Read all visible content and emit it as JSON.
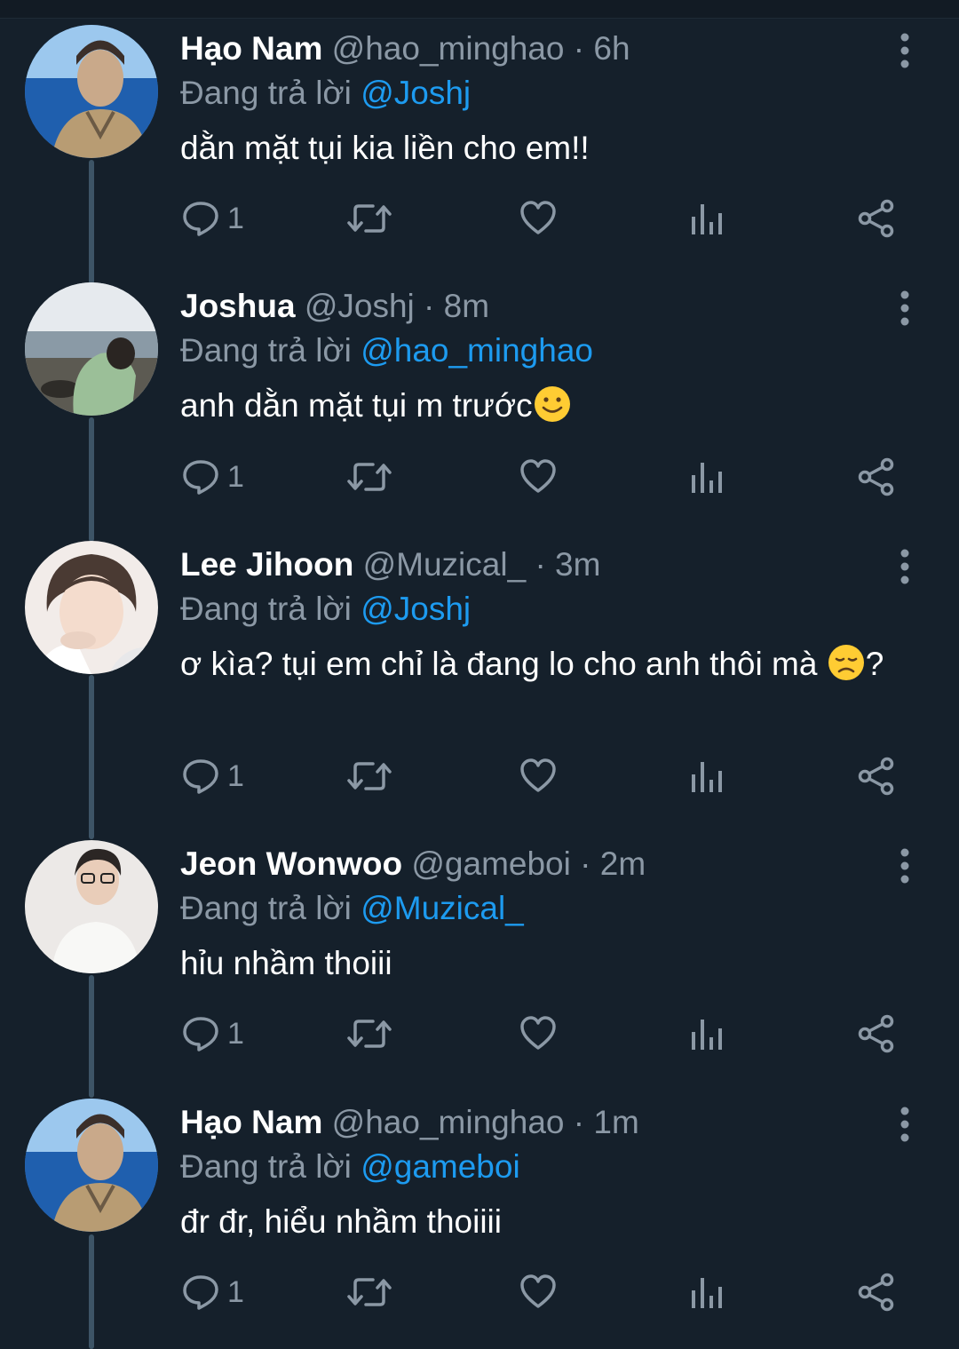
{
  "icons": {
    "reply": "comment-bubble-icon",
    "retweet": "retweet-arrows-icon",
    "like": "heart-outline-icon",
    "views": "bar-chart-icon",
    "share": "share-nodes-icon",
    "more": "vertical-dots-icon"
  },
  "colors": {
    "background": "#15202b",
    "mention": "#1d9bf0",
    "muted": "#8b98a5",
    "text": "#ffffff"
  },
  "tweets": [
    {
      "name": "Hạo Nam",
      "handle": "@hao_minghao",
      "time": "· 6h",
      "replying_label": "Đang trả lời",
      "replying_to": "@Joshj",
      "text": "dằn mặt tụi kia liền cho em!!",
      "emoji_after": "",
      "reply_count": "1"
    },
    {
      "name": "Joshua",
      "handle": "@Joshj",
      "time": "· 8m",
      "replying_label": "Đang trả lời",
      "replying_to": "@hao_minghao",
      "text": "anh dằn mặt tụi m trước",
      "emoji_after": "slightly-smiling-face",
      "reply_count": "1"
    },
    {
      "name": "Lee Jihoon",
      "handle": "@Muzical_",
      "time": "· 3m",
      "replying_label": "Đang trả lời",
      "replying_to": "@Joshj",
      "text": "ơ kìa? tụi em chỉ là đang lo cho anh thôi mà ",
      "emoji_after": "disappointed-face",
      "text_tail": "?",
      "reply_count": "1"
    },
    {
      "name": "Jeon Wonwoo",
      "handle": "@gameboi",
      "time": "· 2m",
      "replying_label": "Đang trả lời",
      "replying_to": "@Muzical_",
      "text": "hỉu nhầm thoiii",
      "emoji_after": "",
      "reply_count": "1"
    },
    {
      "name": "Hạo Nam",
      "handle": "@hao_minghao",
      "time": "· 1m",
      "replying_label": "Đang trả lời",
      "replying_to": "@gameboi",
      "text": "đr đr, hiểu nhầm thoiiii",
      "emoji_after": "",
      "reply_count": "1"
    }
  ]
}
